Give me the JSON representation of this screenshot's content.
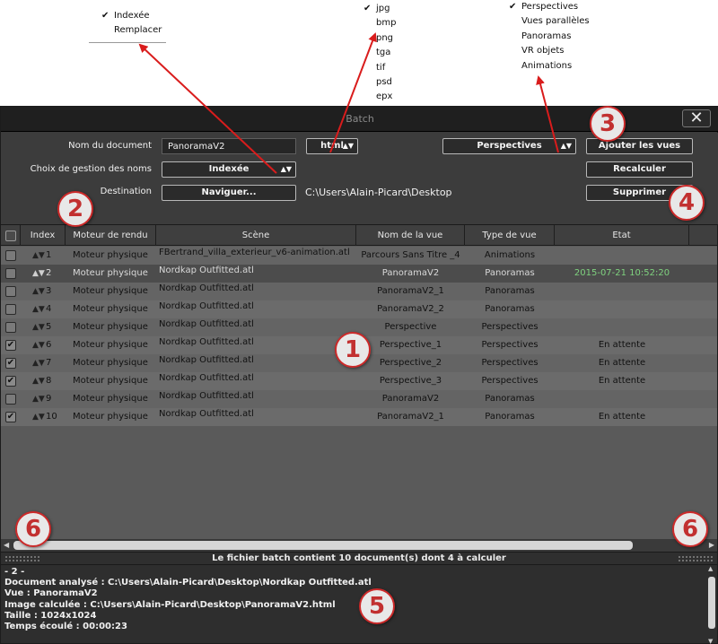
{
  "menus": {
    "naming": {
      "items": [
        {
          "label": "Indexée",
          "checked": true
        },
        {
          "label": "Remplacer",
          "checked": false
        }
      ]
    },
    "format": {
      "items": [
        {
          "label": "jpg",
          "checked": true
        },
        {
          "label": "bmp"
        },
        {
          "label": "png"
        },
        {
          "label": "tga"
        },
        {
          "label": "tif"
        },
        {
          "label": "psd"
        },
        {
          "label": "epx"
        }
      ]
    },
    "views": {
      "items": [
        {
          "label": "Perspectives",
          "checked": true
        },
        {
          "label": "Vues parallèles"
        },
        {
          "label": "Panoramas"
        },
        {
          "label": "VR objets"
        },
        {
          "label": "Animations"
        }
      ]
    }
  },
  "window": {
    "title": "Batch",
    "close_glyph": "✕"
  },
  "form": {
    "doc_name_label": "Nom du document",
    "doc_name_value": "PanoramaV2",
    "format_value": "html",
    "naming_label": "Choix de gestion des noms",
    "naming_value": "Indexée",
    "destination_label": "Destination",
    "browse_label": "Naviguer...",
    "destination_path": "C:\\Users\\Alain-Picard\\Desktop",
    "view_type_value": "Perspectives",
    "add_views_label": "Ajouter les vues",
    "recalc_label": "Recalculer",
    "delete_label": "Supprimer"
  },
  "table": {
    "headers": [
      "Index",
      "Moteur de rendu",
      "Scène",
      "Nom de la vue",
      "Type de vue",
      "Etat"
    ],
    "rows": [
      {
        "checked": false,
        "index": "1",
        "engine": "Moteur physique",
        "scene": "FBertrand_villa_exterieur_v6-animation.atl",
        "view": "Parcours Sans Titre _4",
        "type": "Animations",
        "state": ""
      },
      {
        "checked": false,
        "index": "2",
        "engine": "Moteur physique",
        "scene": "Nordkap Outfitted.atl",
        "view": "PanoramaV2",
        "type": "Panoramas",
        "state": "2015-07-21 10:52:20",
        "selected": true
      },
      {
        "checked": false,
        "index": "3",
        "engine": "Moteur physique",
        "scene": "Nordkap Outfitted.atl",
        "view": "PanoramaV2_1",
        "type": "Panoramas",
        "state": ""
      },
      {
        "checked": false,
        "index": "4",
        "engine": "Moteur physique",
        "scene": "Nordkap Outfitted.atl",
        "view": "PanoramaV2_2",
        "type": "Panoramas",
        "state": ""
      },
      {
        "checked": false,
        "index": "5",
        "engine": "Moteur physique",
        "scene": "Nordkap Outfitted.atl",
        "view": "Perspective",
        "type": "Perspectives",
        "state": ""
      },
      {
        "checked": true,
        "index": "6",
        "engine": "Moteur physique",
        "scene": "Nordkap Outfitted.atl",
        "view": "Perspective_1",
        "type": "Perspectives",
        "state": "En attente"
      },
      {
        "checked": true,
        "index": "7",
        "engine": "Moteur physique",
        "scene": "Nordkap Outfitted.atl",
        "view": "Perspective_2",
        "type": "Perspectives",
        "state": "En attente"
      },
      {
        "checked": true,
        "index": "8",
        "engine": "Moteur physique",
        "scene": "Nordkap Outfitted.atl",
        "view": "Perspective_3",
        "type": "Perspectives",
        "state": "En attente"
      },
      {
        "checked": false,
        "index": "9",
        "engine": "Moteur physique",
        "scene": "Nordkap Outfitted.atl",
        "view": "PanoramaV2",
        "type": "Panoramas",
        "state": ""
      },
      {
        "checked": true,
        "index": "10",
        "engine": "Moteur physique",
        "scene": "Nordkap Outfitted.atl",
        "view": "PanoramaV2_1",
        "type": "Panoramas",
        "state": "En attente"
      }
    ]
  },
  "status_text": "Le fichier batch contient 10 document(s) dont 4 à calculer",
  "log": {
    "lines": [
      "- 2 -",
      "Document analysé : C:\\Users\\Alain-Picard\\Desktop\\Nordkap Outfitted.atl",
      "Vue : PanoramaV2",
      "Image calculée : C:\\Users\\Alain-Picard\\Desktop\\PanoramaV2.html",
      "Taille : 1024x1024",
      "Temps écoulé : 00:00:23"
    ]
  },
  "callouts": [
    "1",
    "2",
    "3",
    "4",
    "5",
    "6",
    "6"
  ],
  "colors": {
    "accent_red": "#cc2a2a",
    "state_green": "#7fd27f",
    "window_bg": "#3b3b3b"
  }
}
